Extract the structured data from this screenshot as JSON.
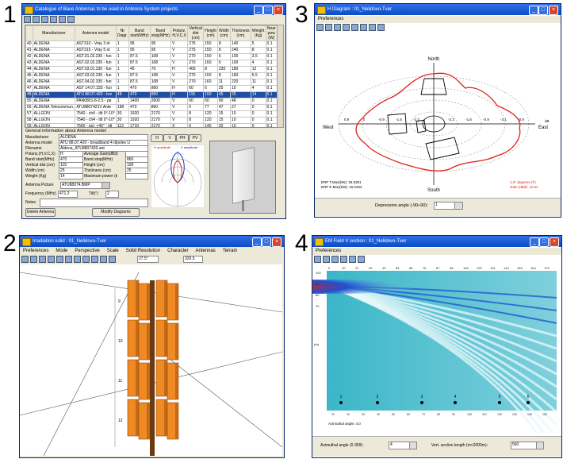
{
  "panel_numbers": [
    "1",
    "2",
    "3",
    "4"
  ],
  "colors": {
    "title_bar": "#0a4cc7",
    "selected_row": "#1f4ea3",
    "antenna_orange": "#f08a24",
    "polar_red": "#e0201b",
    "field_red": "#d82020"
  },
  "w1": {
    "title": "Catalogue of Base Antennas to be used in Antenna System projects",
    "columns": [
      "",
      "Manufacturer",
      "Antenna model",
      "Nr Diagr.",
      "Band start(MHz)",
      "Band stop(MHz)",
      "Polariz. H,V,C,X",
      "Vertical dist (cm)",
      "Height (cm)",
      "Width (cm)",
      "Thickness (cm)",
      "Weight (Kg)",
      "Near pow (W)"
    ],
    "rows": [
      [
        "40",
        "ALDENA",
        "AST310 - Vray 3 st",
        "1",
        "95",
        "95",
        "V",
        "275",
        "150",
        "8",
        "140",
        "5",
        "0.1"
      ],
      [
        "41",
        "ALDENA",
        "AST315 - Vray 5 st",
        "1",
        "95",
        "95",
        "V",
        "275",
        "150",
        "8",
        "240",
        "8",
        "0.1"
      ],
      [
        "42",
        "ALDENA",
        "AST.01.02.235 - fun",
        "1",
        "87.5",
        "108",
        "V",
        "270",
        "150",
        "6",
        "100",
        "3.5",
        "0.1"
      ],
      [
        "43",
        "ALDENA",
        "AST.02.02.335 - fun",
        "1",
        "87.5",
        "108",
        "V",
        "270",
        "160",
        "6",
        "100",
        "4",
        "0.1"
      ],
      [
        "44",
        "ALDENA",
        "AST.03.01.335 - fun",
        "1",
        "45",
        "70",
        "H",
        "400",
        "8",
        "230",
        "180",
        "12",
        "0.1"
      ],
      [
        "45",
        "ALDENA",
        "AST.03.02.335 - fun",
        "1",
        "87.5",
        "108",
        "V",
        "270",
        "150",
        "8",
        "160",
        "5.5",
        "0.1"
      ],
      [
        "46",
        "ALDENA",
        "AST.04.02.335 - fun",
        "1",
        "87.5",
        "108",
        "V",
        "270",
        "160",
        "11",
        "220",
        "11",
        "0.1"
      ],
      [
        "47",
        "ALDENA",
        "AST 14.07.335 - fun",
        "1",
        "470",
        "860",
        "H",
        "60",
        "6",
        "25",
        "10",
        "4",
        "0.1"
      ],
      [
        "48",
        "ALDENA",
        "ATU 88.07.420 - bro",
        "48",
        "470",
        "860",
        "H",
        "115",
        "100",
        "45",
        "25",
        "14",
        "0.1"
      ],
      [
        "55",
        "ALDENA",
        "PAN0801-8-2.5 - pa",
        "1",
        "1400",
        "2600",
        "V",
        "60",
        "60",
        "60",
        "48",
        "0",
        "0.1"
      ],
      [
        "56",
        "ALDENA Telecommun.",
        "ATU8807421V Ante",
        "198",
        "470",
        "860",
        "V",
        "0",
        "77",
        "47",
        "27",
        "0",
        "0.1"
      ],
      [
        "57",
        "ALLGON",
        "7540 - ch4 - tilt 0°-10°",
        "30",
        "1920",
        "2170",
        "V",
        "8",
        "120",
        "15",
        "10",
        "0",
        "0.1"
      ],
      [
        "58",
        "ALLGON",
        "7540 - ch4 - tilt 0°-10°",
        "30",
        "1920",
        "2170",
        "V",
        "8",
        "120",
        "15",
        "10",
        "0",
        "0.1"
      ],
      [
        "59",
        "ALLGON",
        "7560 - pol. +45° - tilt",
        "113",
        "1710",
        "2170",
        "X",
        "6",
        "140",
        "20",
        "10",
        "0",
        "0.1"
      ],
      [
        "60",
        "ALLGON",
        "7560 - pol. +45° - tilt",
        "114",
        "1710",
        "2170",
        "X",
        "6",
        "140",
        "20",
        "10",
        "0",
        "0.1"
      ],
      [
        "61",
        "ALLGON",
        "7565 - pol. +45° - tilt",
        "1",
        "870",
        "960",
        "X",
        "8",
        "260",
        "25",
        "15",
        "0",
        "0.1"
      ]
    ],
    "selected_row_index": 8,
    "general_title": "General information about Antenna model",
    "fields": [
      {
        "label": "Manufacturer",
        "value": "ALDENA"
      },
      {
        "label": "Antenna model",
        "value": "ATU 88.07.420 - broadband 4 dipoles U"
      },
      {
        "label": "Filename",
        "value": "Aldena_ATU8807420.ant"
      },
      {
        "label": "Polariz.(H,V,C,X)",
        "value": "H"
      },
      {
        "label": "Band start(MHz)",
        "value": "470"
      },
      {
        "label": "Vertical dist.(cm)",
        "value": "115"
      },
      {
        "label": "Width (cm)",
        "value": "25"
      },
      {
        "label": "Weight (Kg)",
        "value": "14"
      }
    ],
    "fields_right": [
      {
        "label": "Average Gain(dBd)",
        "value": ""
      },
      {
        "label": "Band stop(MHz)",
        "value": "860"
      },
      {
        "label": "Height (cm)",
        "value": "100"
      },
      {
        "label": "Thickness (cm)",
        "value": "25"
      },
      {
        "label": "Maximum power (k",
        "value": ""
      }
    ],
    "antenna_picture_label": "Antenna Picture",
    "antenna_picture_value": "ATU88074.BMP",
    "frequency_label": "Frequency (MHz)",
    "frequency_value": "471.2",
    "tilt_label": "Tilt(°)",
    "tilt_value": "2",
    "notes_label": "Notes",
    "tabs": [
      "H",
      "V",
      "PH",
      "PV"
    ],
    "h_amplitude": "H amplitude",
    "v_amplitude": "V amplitude",
    "delete_button": "Delete Antenna",
    "modify_button": "Modify Diagrams"
  },
  "w2": {
    "title": "Irradiation solid : 01_Nelidovo-Tver",
    "menu": [
      "Preferences",
      "Mode",
      "Perspective",
      "Scale",
      "Solid Resolution",
      "Character",
      "Antennas",
      "Terrain"
    ],
    "readout1": "27.5°",
    "readout2": "329.5",
    "level_labels": [
      "9",
      "10",
      "11",
      "12"
    ]
  },
  "w3": {
    "title": "H Diagram : 01_Nelidovo-Tver",
    "menu": "Preferences",
    "north": "North",
    "south": "South",
    "west": "West",
    "east": "East",
    "unit": "dB",
    "axis_left": [
      "0.9",
      "0",
      "-0.9",
      "-1.5",
      "-2.3"
    ],
    "axis_right": [
      "-2.3",
      "-1.6",
      "-0.9",
      "-3.1",
      "-0.9"
    ],
    "erp_t": "ERP T.Max(kW): 35.9301",
    "erp_e": "ERP E.Max(kW): 16.0494",
    "degrees": "1.0° degrees (T)",
    "gain": "Gain (dBd): 12.54",
    "depression_label": "Depression angle (-90÷90):",
    "depression_value": "1"
  },
  "w4": {
    "title": "EM Field V section : 01_Nelidovo-Tver",
    "menu": "Preferences",
    "top_ticks": [
      "0",
      "10",
      "21",
      "32",
      "43",
      "54",
      "65",
      "76",
      "87",
      "98",
      "109",
      "120",
      "131",
      "142",
      "153",
      "164",
      "175"
    ],
    "left_ticks": [
      "100",
      "90",
      "80",
      "70"
    ],
    "y_unit": "(m)",
    "markers": [
      "1",
      "2",
      "3",
      "4",
      "5",
      "6"
    ],
    "bottom_ticks": [
      "10",
      "20",
      "30",
      "40",
      "50",
      "60",
      "70",
      "80",
      "90",
      "100",
      "110",
      "120",
      "130",
      "140",
      "150"
    ],
    "azimuth_status": "Azimuthal angle: 4.0",
    "azimuth_label": "Azimuthal angle (0-359):",
    "azimuth_value": "4",
    "section_label": "Vert. section length (m<2000m):",
    "section_value": "560"
  }
}
